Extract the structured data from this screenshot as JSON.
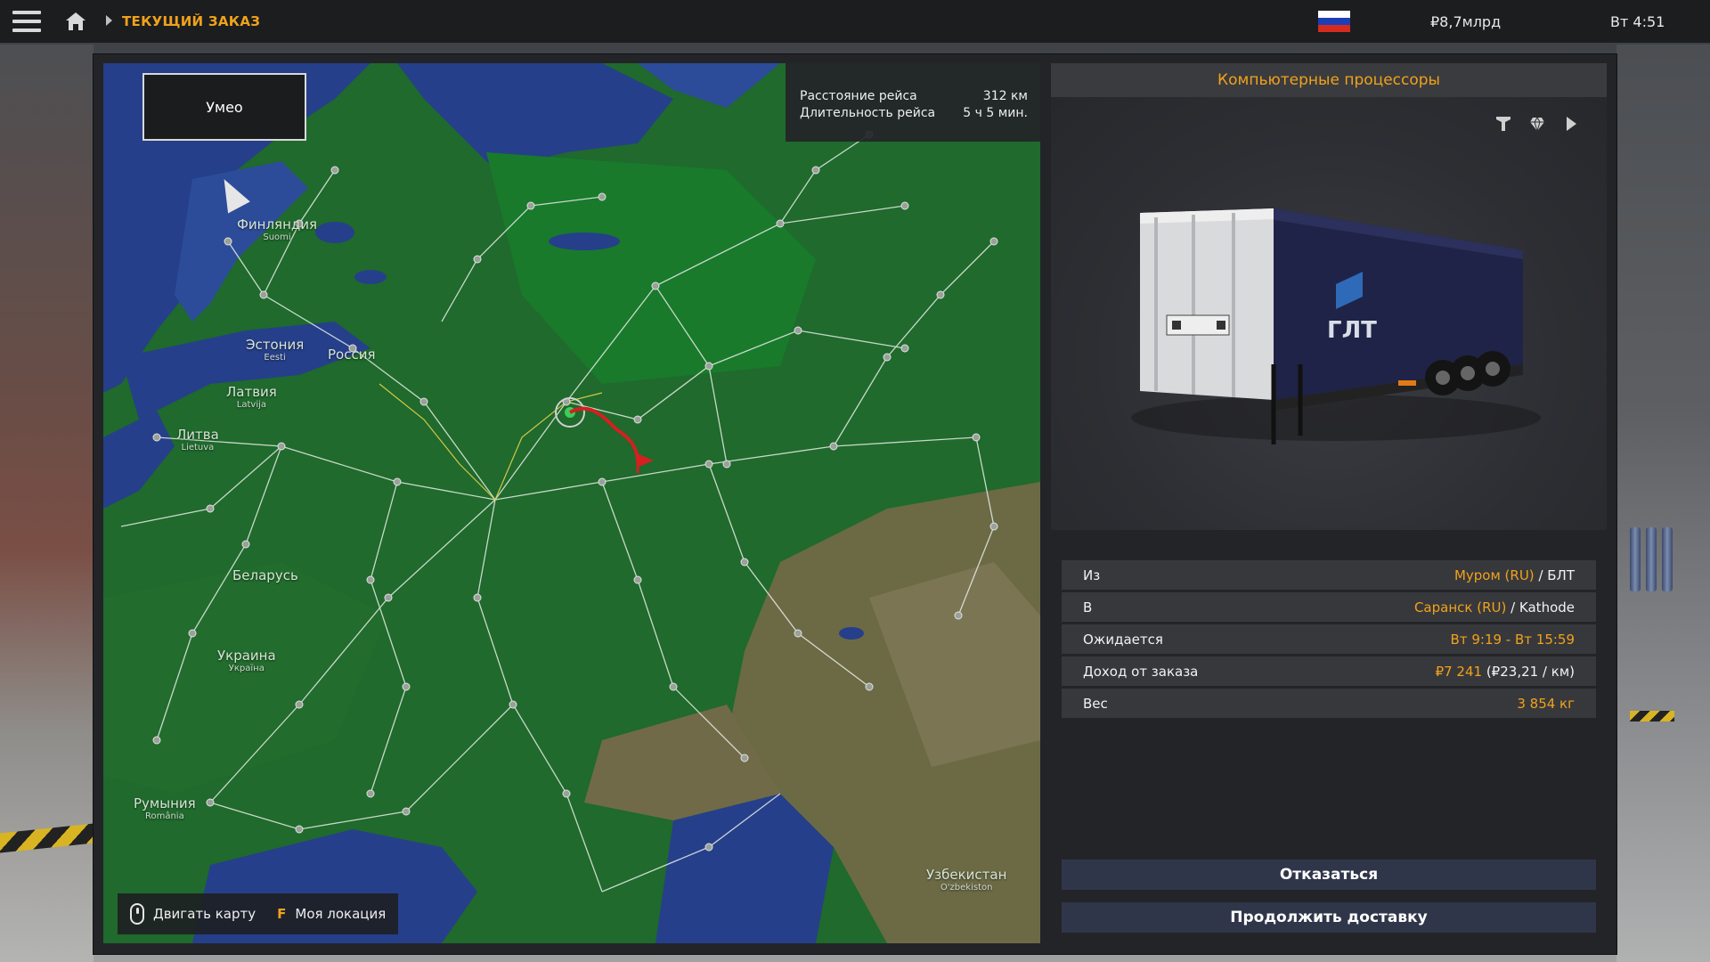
{
  "topbar": {
    "breadcrumb": "ТЕКУЩИЙ ЗАКАЗ",
    "money": "₽8,7млрд",
    "clock": "Вт 4:51",
    "flag_colors": [
      "#ffffff",
      "#1c3fb7",
      "#d52b1e"
    ]
  },
  "map": {
    "mode_label": "Умео",
    "trip_info": {
      "distance_label": "Расстояние рейса",
      "distance_value": "312 км",
      "duration_label": "Длительность рейса",
      "duration_value": "5 ч 5 мин."
    },
    "hints": {
      "move_label": "Двигать карту",
      "location_key": "F",
      "location_label": "Моя локация"
    },
    "labels": [
      {
        "name": "Финляндия",
        "sub": "Suomi"
      },
      {
        "name": "Эстония",
        "sub": "Eesti"
      },
      {
        "name": "Латвия",
        "sub": "Latvija"
      },
      {
        "name": "Литва",
        "sub": "Lietuva"
      },
      {
        "name": "Беларусь",
        "sub": ""
      },
      {
        "name": "Украина",
        "sub": "Україна"
      },
      {
        "name": "Румыния",
        "sub": "România"
      },
      {
        "name": "Узбекистан",
        "sub": "O'zbekiston"
      },
      {
        "name": "Россия",
        "sub": ""
      }
    ]
  },
  "cargo": {
    "title": "Компьютерные процессоры",
    "trailer_brand": "ГЛТ"
  },
  "details": [
    {
      "label": "Из",
      "city": "Муром (RU)",
      "company": " / БЛТ"
    },
    {
      "label": "В",
      "city": "Саранск (RU)",
      "company": " / Kathode"
    },
    {
      "label": "Ожидается",
      "city": "Вт 9:19 - Вт 15:59",
      "company": ""
    },
    {
      "label": "Доход от заказа",
      "city": "₽7 241",
      "company": " (₽23,21 / км)"
    },
    {
      "label": "Вес",
      "city": "3 854 кг",
      "company": ""
    }
  ],
  "buttons": {
    "cancel": "Отказаться",
    "continue": "Продолжить доставку"
  },
  "colors": {
    "accent": "#f0a21b",
    "route": "#d42020",
    "land": "#1f6a2c",
    "water": "#263f8a"
  }
}
